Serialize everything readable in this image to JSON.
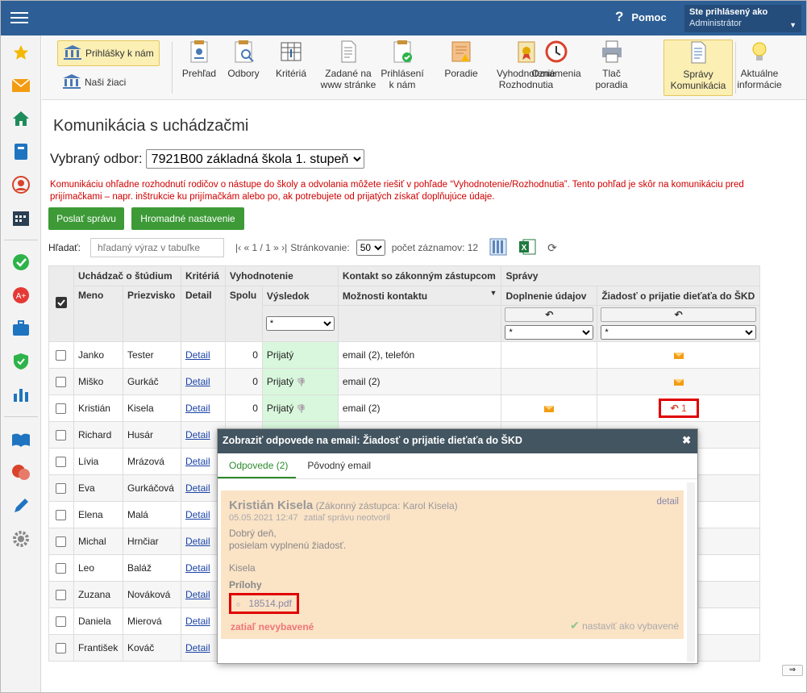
{
  "topbar": {
    "help_label": "Pomoc",
    "help_glyph": "?",
    "user_line1": "Ste prihlásený ako",
    "user_line2": "Administrátor"
  },
  "sidebar_icons": [
    "star-icon",
    "mail-icon",
    "home-icon",
    "book-icon",
    "person-icon",
    "calendar-icon",
    "check-icon",
    "badge-icon",
    "briefcase-icon",
    "shield-icon",
    "chart-icon",
    "reader-icon",
    "chat-icon",
    "pencil-icon",
    "gear-icon"
  ],
  "toolbar": {
    "left_buttons": [
      "Prihlášky k nám",
      "Naši žiaci"
    ],
    "buttons": [
      [
        "Prehľad"
      ],
      [
        "Odbory"
      ],
      [
        "Kritériá"
      ],
      [
        "Zadané na",
        "www stránke"
      ],
      [
        "Prihlásení",
        "k nám"
      ],
      [
        "Poradie"
      ],
      [
        "Vyhodnotenie",
        "Rozhodnutia"
      ],
      [
        "Oznámenia"
      ],
      [
        "Tlač",
        "poradia"
      ],
      [
        "Správy",
        "Komunikácia"
      ],
      [
        "Aktuálne",
        "informácie"
      ]
    ]
  },
  "page": {
    "title": "Komunikácia s uchádzačmi",
    "odbor_label": "Vybraný odbor:",
    "odbor_value": "7921B00 základná škola 1. stupeň",
    "notice": "Komunikáciu ohľadne rozhodnutí rodičov o nástupe do školy a odvolania môžete riešiť v pohľade “Vyhodnotenie/Rozhodnutia”. Tento pohľad je skôr na komunikáciu pred prijímačkami – napr. inštrukcie ku prijímačkám alebo po, ak potrebujete od prijatých získať doplňujúce údaje.",
    "btn_send": "Poslať správu",
    "btn_bulk": "Hromadné nastavenie",
    "search_label": "Hľadať:",
    "search_placeholder": "hľadaný výraz v tabuľke",
    "pager": "|‹ « 1 / 1 » ›|",
    "page_size_label": "Stránkovanie:",
    "page_size": "50",
    "record_count": "počet záznamov: 12"
  },
  "table": {
    "h_uchadzac": "Uchádzač o štúdium",
    "h_kriteria": "Kritériá",
    "h_vyhodnotenie": "Vyhodnotenie",
    "h_kontakt": "Kontakt so zákonným zástupcom",
    "h_spravy": "Správy",
    "h_meno": "Meno",
    "h_priezvisko": "Priezvisko",
    "h_detail": "Detail",
    "h_spolu": "Spolu",
    "h_vysledok": "Výsledok",
    "h_moznosti": "Možnosti kontaktu",
    "h_doplnenie": "Doplnenie údajov",
    "h_ziadost": "Žiadosť o prijatie dieťaťa do ŠKD",
    "filter_value": "*",
    "rows": [
      {
        "meno": "Janko",
        "priezvisko": "Tester",
        "detail": "Detail",
        "spolu": "0",
        "vysledok": "Prijatý",
        "thumb": false,
        "kontakt": "email (2), telefón",
        "doplnenie": false,
        "ziadost": "mail"
      },
      {
        "meno": "Miško",
        "priezvisko": "Gurkáč",
        "detail": "Detail",
        "spolu": "0",
        "vysledok": "Prijatý",
        "thumb": true,
        "kontakt": "email (2)",
        "doplnenie": false,
        "ziadost": "mail"
      },
      {
        "meno": "Kristián",
        "priezvisko": "Kisela",
        "detail": "Detail",
        "spolu": "0",
        "vysledok": "Prijatý",
        "thumb": true,
        "kontakt": "email (2)",
        "doplnenie": true,
        "ziadost": "reply",
        "reply_count": "1"
      },
      {
        "meno": "Richard",
        "priezvisko": "Husár",
        "detail": "Detail"
      },
      {
        "meno": "Lívia",
        "priezvisko": "Mrázová",
        "detail": "Detail"
      },
      {
        "meno": "Eva",
        "priezvisko": "Gurkáčová",
        "detail": "Detail"
      },
      {
        "meno": "Elena",
        "priezvisko": "Malá",
        "detail": "Detail"
      },
      {
        "meno": "Michal",
        "priezvisko": "Hrnčiar",
        "detail": "Detail"
      },
      {
        "meno": "Leo",
        "priezvisko": "Baláž",
        "detail": "Detail"
      },
      {
        "meno": "Zuzana",
        "priezvisko": "Nováková",
        "detail": "Detail"
      },
      {
        "meno": "Daniela",
        "priezvisko": "Mierová",
        "detail": "Detail"
      },
      {
        "meno": "František",
        "priezvisko": "Kováč",
        "detail": "Detail"
      }
    ]
  },
  "popup": {
    "title": "Zobraziť odpovede na email: Žiadosť o prijatie dieťaťa do ŠKD",
    "tab_replies": "Odpovede (2)",
    "tab_original": "Pôvodný email",
    "sender": "Kristián Kisela",
    "guardian": "(Zákonný zástupca: Karol Kisela)",
    "date": "05.05.2021 12:47",
    "read_status": "zatiaľ správu neotvoril",
    "detail_link": "detail",
    "line1": "Dobrý deň,",
    "line2": "posielam vyplnenú žiadosť.",
    "signature": "Kisela",
    "attachments_label": "Prílohy",
    "attachment": "18514.pdf",
    "pending": "zatiaľ nevybavené",
    "mark_done": "nastaviť ako vybavené"
  },
  "colors": {
    "topbar": "#2d5f96",
    "accent_green": "#3d9a37",
    "notice_red": "#d10000",
    "highlight": "#e00000",
    "result_bg": "#d8f7dc"
  }
}
